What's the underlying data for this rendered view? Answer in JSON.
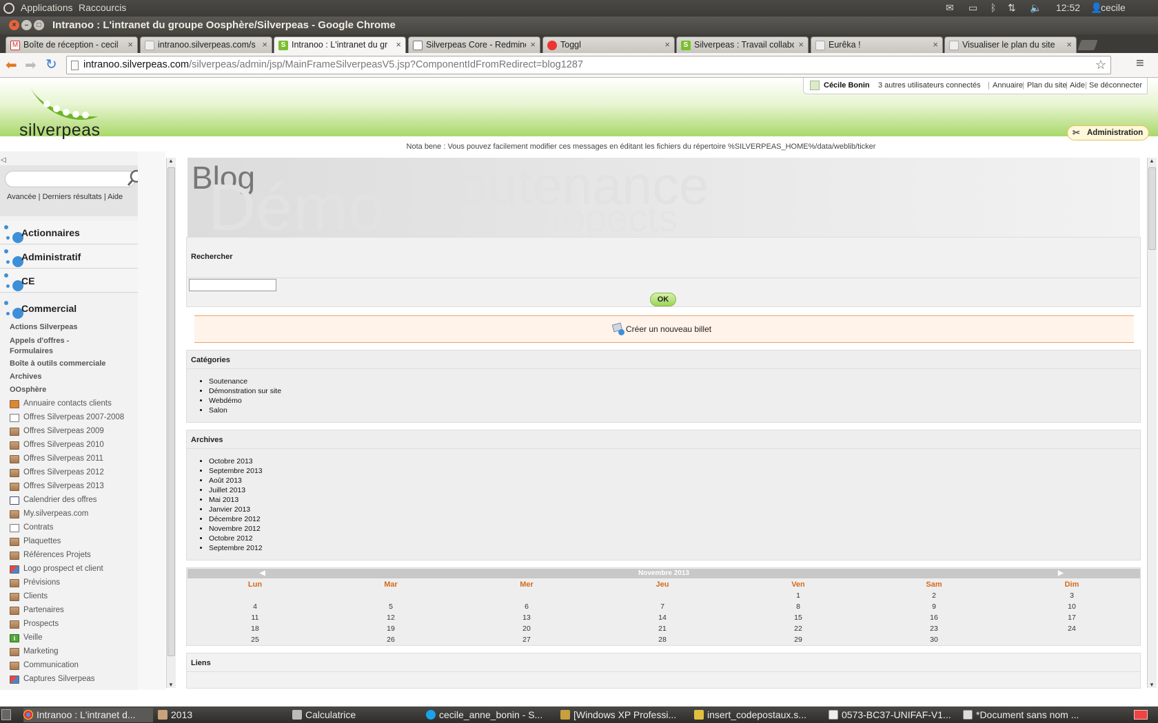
{
  "os_panel": {
    "menu_applications": "Applications",
    "menu_shortcuts": "Raccourcis",
    "clock": "12:52",
    "user": "cecile"
  },
  "window": {
    "title": "Intranoo : L'intranet du groupe Oosphère/Silverpeas - Google Chrome"
  },
  "tabs": [
    {
      "label": "Boîte de réception - cecil",
      "icon": "gmail-icon"
    },
    {
      "label": "intranoo.silverpeas.com/s",
      "icon": "page-icon"
    },
    {
      "label": "Intranoo : L'intranet du gr",
      "icon": "silverpeas-icon",
      "active": true
    },
    {
      "label": "Silverpeas Core - Redmine",
      "icon": "redmine-icon"
    },
    {
      "label": "Toggl",
      "icon": "toggl-icon"
    },
    {
      "label": "Silverpeas : Travail collabc",
      "icon": "silverpeas-icon"
    },
    {
      "label": "Eurêka !",
      "icon": "page-icon"
    },
    {
      "label": "Visualiser le plan du site",
      "icon": "page-icon"
    }
  ],
  "address": {
    "host": "intranoo.silverpeas.com",
    "path": "/silverpeas/admin/jsp/MainFrameSilverpeasV5.jsp?ComponentIdFromRedirect=blog1287"
  },
  "header": {
    "logo_text": "silverpeas",
    "user_name": "Cécile Bonin",
    "connected": "3 autres utilisateurs connectés",
    "links": [
      "Annuaire",
      "Plan du site",
      "Aide",
      "Se déconnecter"
    ],
    "admin_label": "Administration",
    "ticker": "Nota bene : Vous pouvez facilement modifier ces messages en éditant les fichiers du répertoire %SILVERPEAS_HOME%/data/weblib/ticker"
  },
  "left": {
    "search_links": "Avancée | Derniers résultats | Aide",
    "spaces": [
      "Actionnaires",
      "Administratif",
      "CE",
      "Commercial"
    ],
    "subspaces": [
      "Actions Silverpeas",
      "Appels d'offres - Formulaires",
      "Boîte à outils commerciale",
      "Archives",
      "OOsphère"
    ],
    "items": [
      {
        "label": "Annuaire contacts clients",
        "icon": "contacts-icon"
      },
      {
        "label": "Offres Silverpeas 2007-2008",
        "icon": "docs-icon"
      },
      {
        "label": "Offres Silverpeas 2009",
        "icon": "folder-icon"
      },
      {
        "label": "Offres Silverpeas 2010",
        "icon": "folder-icon"
      },
      {
        "label": "Offres Silverpeas 2011",
        "icon": "folder-icon"
      },
      {
        "label": "Offres Silverpeas 2012",
        "icon": "folder-icon"
      },
      {
        "label": "Offres Silverpeas 2013",
        "icon": "folder-icon"
      },
      {
        "label": "Calendrier des offres",
        "icon": "calendar-icon"
      },
      {
        "label": "My.silverpeas.com",
        "icon": "folder-icon"
      },
      {
        "label": "Contrats",
        "icon": "docs-icon"
      },
      {
        "label": "Plaquettes",
        "icon": "folder-icon"
      },
      {
        "label": "Références Projets",
        "icon": "folder-icon"
      },
      {
        "label": "Logo prospect et client",
        "icon": "gallery-icon"
      },
      {
        "label": "Prévisions",
        "icon": "folder-icon"
      },
      {
        "label": "Clients",
        "icon": "folder-icon"
      },
      {
        "label": "Partenaires",
        "icon": "folder-icon"
      },
      {
        "label": "Prospects",
        "icon": "folder-icon"
      },
      {
        "label": "Veille",
        "icon": "info-icon"
      },
      {
        "label": "Marketing",
        "icon": "folder-icon"
      },
      {
        "label": "Communication",
        "icon": "folder-icon"
      },
      {
        "label": "Captures Silverpeas",
        "icon": "gallery-icon"
      }
    ]
  },
  "blog": {
    "title": "Blog",
    "banner_words": [
      "Démo",
      "Soutenance",
      "Propects"
    ],
    "search_title": "Rechercher",
    "ok_label": "OK",
    "create_label": "Créer un nouveau billet",
    "categories_title": "Catégories",
    "categories": [
      "Soutenance",
      "Démonstration sur site",
      "Webdémo",
      "Salon"
    ],
    "archives_title": "Archives",
    "archives": [
      "Octobre 2013",
      "Septembre 2013",
      "Août 2013",
      "Juillet 2013",
      "Mai 2013",
      "Janvier 2013",
      "Décembre 2012",
      "Novembre 2012",
      "Octobre 2012",
      "Septembre 2012"
    ],
    "links_title": "Liens"
  },
  "calendar": {
    "month": "Novembre 2013",
    "prev": "◀",
    "next": "▶",
    "days": [
      "Lun",
      "Mar",
      "Mer",
      "Jeu",
      "Ven",
      "Sam",
      "Dim"
    ],
    "weeks": [
      [
        "",
        "",
        "",
        "",
        "1",
        "2",
        "3"
      ],
      [
        "4",
        "5",
        "6",
        "7",
        "8",
        "9",
        "10"
      ],
      [
        "11",
        "12",
        "13",
        "14",
        "15",
        "16",
        "17"
      ],
      [
        "18",
        "19",
        "20",
        "21",
        "22",
        "23",
        "24"
      ],
      [
        "25",
        "26",
        "27",
        "28",
        "29",
        "30",
        ""
      ]
    ]
  },
  "taskbar": [
    {
      "label": "Intranoo : L'intranet d...",
      "icon": "chrome-icon"
    },
    {
      "label": "2013",
      "icon": "folder-icon"
    },
    {
      "label": "Calculatrice",
      "icon": "calculator-icon"
    },
    {
      "label": "cecile_anne_bonin - S...",
      "icon": "skype-icon"
    },
    {
      "label": "[Windows XP Professi...",
      "icon": "vm-icon"
    },
    {
      "label": "insert_codepostaux.s...",
      "icon": "script-icon"
    },
    {
      "label": "0573-BC37-UNIFAF-V1...",
      "icon": "document-icon"
    },
    {
      "label": "*Document sans nom ...",
      "icon": "editor-icon"
    }
  ]
}
